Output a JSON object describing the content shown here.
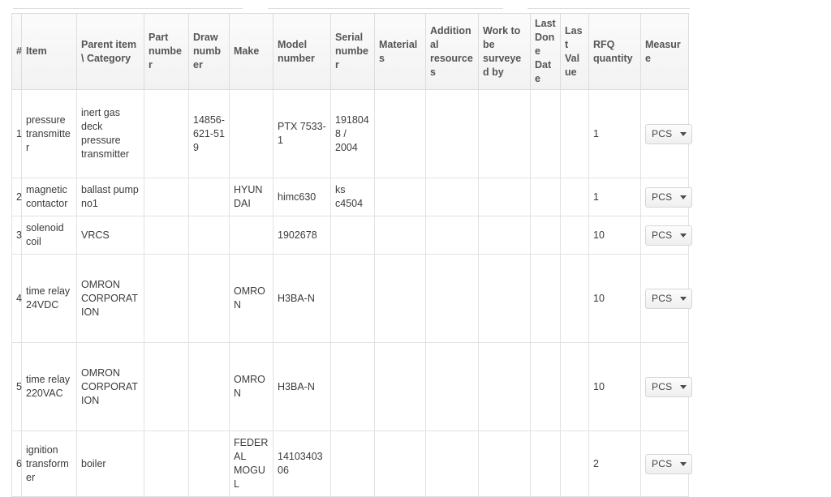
{
  "table": {
    "name": "rfq-items-table",
    "columns": [
      {
        "key": "idx",
        "label": "#"
      },
      {
        "key": "item",
        "label": "Item"
      },
      {
        "key": "parent",
        "label": "Parent item \\ Category"
      },
      {
        "key": "part",
        "label": "Part number"
      },
      {
        "key": "draw",
        "label": "Draw number"
      },
      {
        "key": "make",
        "label": "Make"
      },
      {
        "key": "model",
        "label": "Model number"
      },
      {
        "key": "serial",
        "label": "Serial number"
      },
      {
        "key": "mat",
        "label": "Materials"
      },
      {
        "key": "addres",
        "label": "Additional resources"
      },
      {
        "key": "work",
        "label": "Work to be surveyed by"
      },
      {
        "key": "ldd",
        "label": "Last Done Date"
      },
      {
        "key": "lval",
        "label": "Last Value"
      },
      {
        "key": "rfq",
        "label": "RFQ quantity"
      },
      {
        "key": "measure",
        "label": "Measure"
      }
    ],
    "rows": [
      {
        "idx": "1",
        "item": "pressure transmitter",
        "parent": "inert gas deck pressure transmitter",
        "part": "",
        "draw": "14856-621-51 9",
        "make": "",
        "model": "PTX 7533-1",
        "serial": "1918048 / 2004",
        "mat": "",
        "addres": "",
        "work": "",
        "ldd": "",
        "lval": "",
        "rfq": "1",
        "measure": "PCS"
      },
      {
        "idx": "2",
        "item": "magnetic contactor",
        "parent": "ballast pump no1",
        "part": "",
        "draw": "",
        "make": "HYUNDAI",
        "model": "himc630",
        "serial": "ks c4504",
        "mat": "",
        "addres": "",
        "work": "",
        "ldd": "",
        "lval": "",
        "rfq": "1",
        "measure": "PCS"
      },
      {
        "idx": "3",
        "item": "solenoid coil",
        "parent": "VRCS",
        "part": "",
        "draw": "",
        "make": "",
        "model": "1902678",
        "serial": "",
        "mat": "",
        "addres": "",
        "work": "",
        "ldd": "",
        "lval": "",
        "rfq": "10",
        "measure": "PCS"
      },
      {
        "idx": "4",
        "item": "time relay 24VDC",
        "parent": "OMRON CORPORATION",
        "part": "",
        "draw": "",
        "make": "OMRON",
        "model": "H3BA-N",
        "serial": "",
        "mat": "",
        "addres": "",
        "work": "",
        "ldd": "",
        "lval": "",
        "rfq": "10",
        "measure": "PCS"
      },
      {
        "idx": "5",
        "item": "time relay 220VAC",
        "parent": "OMRON CORPORATION",
        "part": "",
        "draw": "",
        "make": "OMRON",
        "model": "H3BA-N",
        "serial": "",
        "mat": "",
        "addres": "",
        "work": "",
        "ldd": "",
        "lval": "",
        "rfq": "10",
        "measure": "PCS"
      },
      {
        "idx": "6",
        "item": "ignition transformer",
        "parent": "boiler",
        "part": "",
        "draw": "",
        "make": "FEDERAL MOGUL",
        "model": "1410340306",
        "serial": "",
        "mat": "",
        "addres": "",
        "work": "",
        "ldd": "",
        "lval": "",
        "rfq": "2",
        "measure": "PCS"
      }
    ]
  },
  "icons": {
    "dropdown_caret": "chevron-down-icon"
  },
  "colors": {
    "header_bg_top": "#fbfbfb",
    "header_bg_bottom": "#f2f2f2",
    "border": "#dddddd",
    "cell_border": "#e2e2e2",
    "text": "#3b3b3b",
    "header_text": "#555555",
    "page_bg": "#ffffff"
  }
}
